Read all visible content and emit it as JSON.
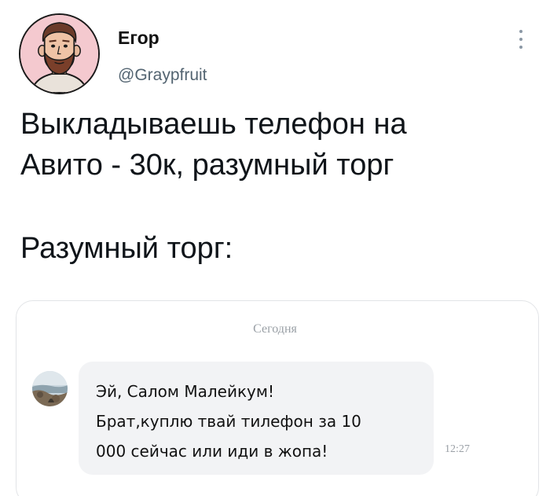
{
  "author": {
    "name": "Егор",
    "handle": "@Graypfruit",
    "avatar_icon": "bearded-man-avatar-icon"
  },
  "header": {
    "more_icon": "vertical-ellipsis-icon"
  },
  "tweet": {
    "lines": [
      "Выкладываешь телефон на",
      "Авито - 30к, разумный торг",
      "Разумный торг:"
    ]
  },
  "chat": {
    "day_label": "Сегодня",
    "contact_avatar_icon": "seaside-photo-avatar-icon",
    "message": {
      "lines": [
        "Эй, Салом Малейкум!",
        "Брат,куплю твай тилефон за 10",
        "000 сейчас или иди в жопа!"
      ],
      "time": "12:27"
    },
    "colors": {
      "bubble": "#f2f3f5",
      "meta_text": "#9aa0a6"
    }
  }
}
